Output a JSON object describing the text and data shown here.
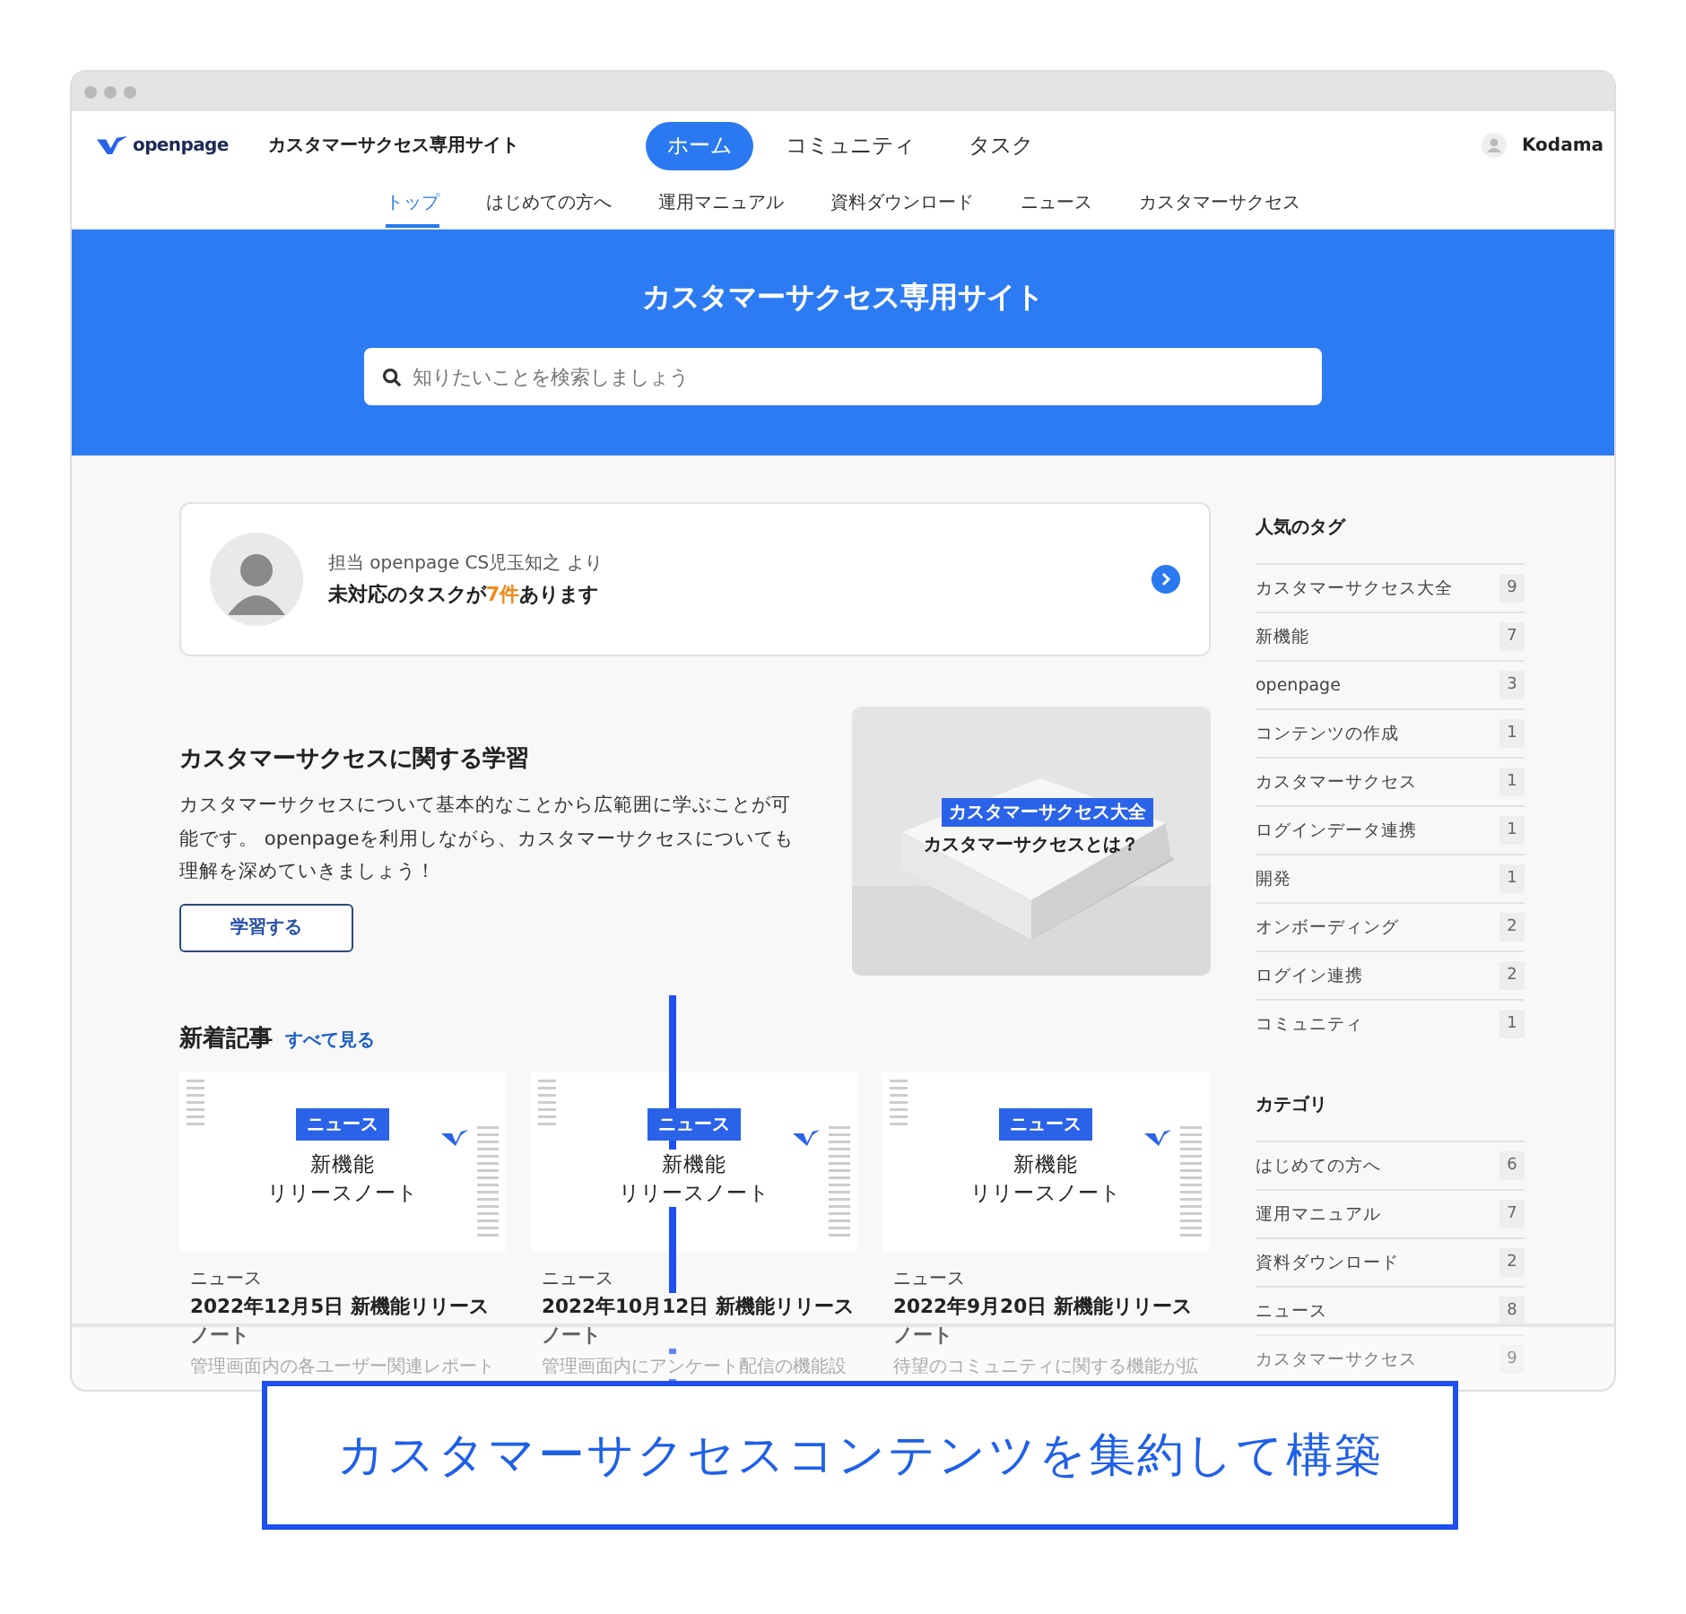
{
  "header": {
    "logo": "openpage",
    "site_name": "カスタマーサクセス専用サイト",
    "nav": [
      {
        "label": "ホーム",
        "selected": true
      },
      {
        "label": "コミュニティ",
        "selected": false
      },
      {
        "label": "タスク",
        "selected": false
      }
    ],
    "user": "Kodama"
  },
  "subnav": [
    {
      "label": "トップ",
      "selected": true
    },
    {
      "label": "はじめての方へ",
      "selected": false
    },
    {
      "label": "運用マニュアル",
      "selected": false
    },
    {
      "label": "資料ダウンロード",
      "selected": false
    },
    {
      "label": "ニュース",
      "selected": false
    },
    {
      "label": "カスタマーサクセス",
      "selected": false
    }
  ],
  "hero": {
    "title": "カスタマーサクセス専用サイト",
    "search": {
      "placeholder": "知りたいことを検索しましょう"
    }
  },
  "task_card": {
    "from_line": "担当 openpage CS児玉知之 より",
    "message_parts": [
      {
        "text": "未対応のタスクが",
        "highlight": false
      },
      {
        "text": "7件",
        "highlight": true
      },
      {
        "text": "あります",
        "highlight": false
      }
    ]
  },
  "learning": {
    "title": "カスタマーサクセスに関する学習",
    "description": "カスタマーサクセスについて基本的なことから広範囲に学ぶことが可能です。 openpageを利用しながら、カスタマーサクセスについても理解を深めていきましょう！",
    "button": "学習する",
    "image": {
      "kind": "picture",
      "tag": "カスタマーサクセス大全",
      "caption": "カスタマーサクセスとは？"
    }
  },
  "news": {
    "title": "新着記事",
    "link": "すべて見る",
    "articles": [
      {
        "thumb_tag": "ニュース",
        "thumb_title_lines": [
          "新機能",
          "リリースノート"
        ],
        "category": "ニュース",
        "title": "2022年12月5日 新機能リリースノート",
        "excerpt": "管理画面内の各ユーザー関連レポート"
      },
      {
        "thumb_tag": "ニュース",
        "thumb_title_lines": [
          "新機能",
          "リリースノート"
        ],
        "category": "ニュース",
        "title": "2022年10月12日 新機能リリースノート",
        "excerpt": "管理画面内にアンケート配信の機能設"
      },
      {
        "thumb_tag": "ニュース",
        "thumb_title_lines": [
          "新機能",
          "リリースノート"
        ],
        "category": "ニュース",
        "title": "2022年9月20日 新機能リリースノート",
        "excerpt": "待望のコミュニティに関する機能が拡"
      }
    ]
  },
  "sidebar": {
    "sections": [
      {
        "title": "人気のタグ",
        "items": [
          {
            "name": "カスタマーサクセス大全",
            "count": "9"
          },
          {
            "name": "新機能",
            "count": "7"
          },
          {
            "name": "openpage",
            "count": "3"
          },
          {
            "name": "コンテンツの作成",
            "count": "1"
          },
          {
            "name": "カスタマーサクセス",
            "count": "1"
          },
          {
            "name": "ログインデータ連携",
            "count": "1"
          },
          {
            "name": "開発",
            "count": "1"
          },
          {
            "name": "オンボーディング",
            "count": "2"
          },
          {
            "name": "ログイン連携",
            "count": "2"
          },
          {
            "name": "コミュニティ",
            "count": "1"
          }
        ]
      },
      {
        "title": "カテゴリ",
        "items": [
          {
            "name": "はじめての方へ",
            "count": "6"
          },
          {
            "name": "運用マニュアル",
            "count": "7"
          },
          {
            "name": "資料ダウンロード",
            "count": "2"
          },
          {
            "name": "ニュース",
            "count": "8"
          },
          {
            "name": "カスタマーサクセス",
            "count": "9"
          }
        ]
      }
    ]
  },
  "callout": {
    "text": "カスタマーサクセスコンテンツを集約して構築"
  }
}
